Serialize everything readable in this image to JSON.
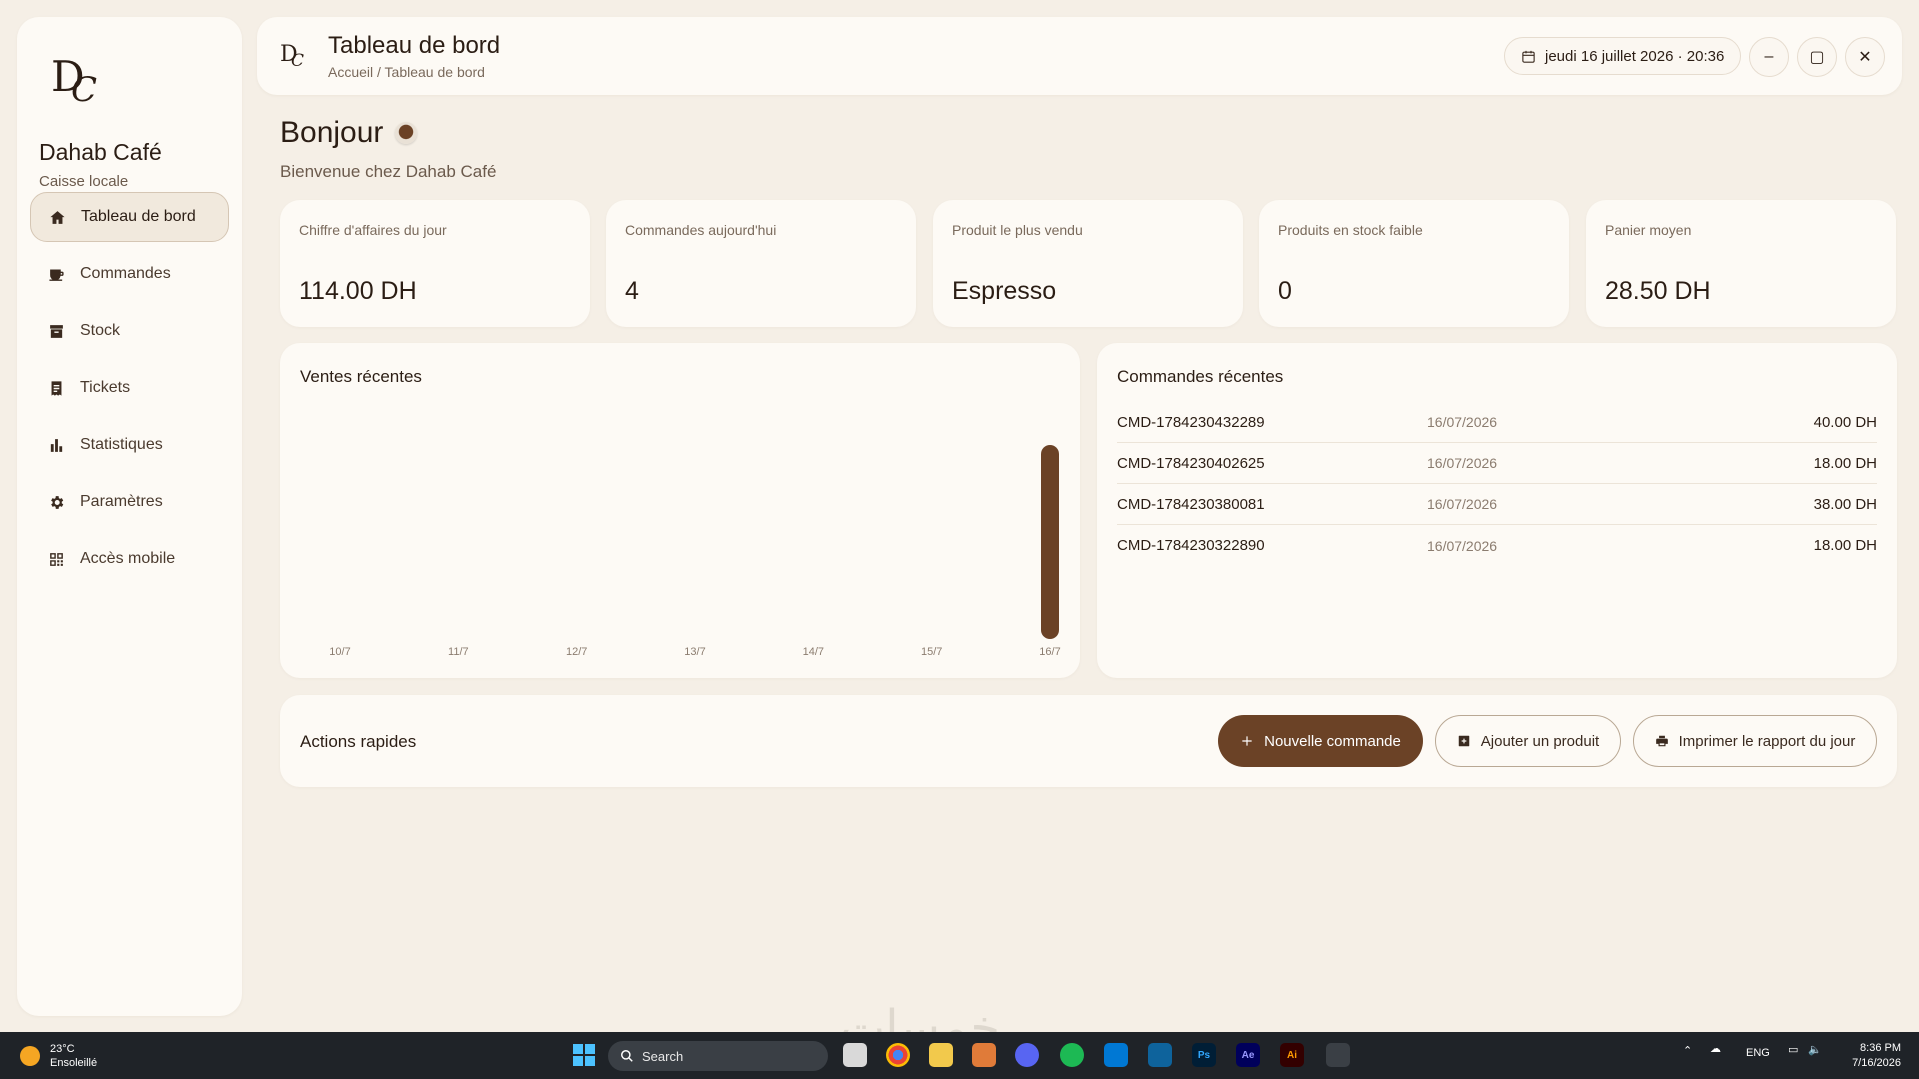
{
  "sidebar": {
    "brand_name": "Dahab Café",
    "brand_sub": "Caisse locale",
    "items": [
      {
        "label": "Tableau de bord",
        "icon": "home-icon"
      },
      {
        "label": "Commandes",
        "icon": "coffee-cup-icon"
      },
      {
        "label": "Stock",
        "icon": "archive-box-icon"
      },
      {
        "label": "Tickets",
        "icon": "receipt-icon"
      },
      {
        "label": "Statistiques",
        "icon": "bar-chart-icon"
      },
      {
        "label": "Paramètres",
        "icon": "gear-icon"
      },
      {
        "label": "Accès mobile",
        "icon": "qr-code-icon"
      }
    ]
  },
  "header": {
    "title": "Tableau de bord",
    "breadcrumb": "Accueil / Tableau de bord",
    "datetime": "jeudi 16 juillet 2026 · 20:36",
    "minimize": "–",
    "maximize": "▢",
    "close": "✕"
  },
  "greeting": {
    "title": "Bonjour",
    "subtitle": "Bienvenue chez Dahab Café"
  },
  "stats": [
    {
      "label": "Chiffre d'affaires du jour",
      "value": "114.00 DH"
    },
    {
      "label": "Commandes aujourd'hui",
      "value": "4"
    },
    {
      "label": "Produit le plus vendu",
      "value": "Espresso"
    },
    {
      "label": "Produits en stock faible",
      "value": "0"
    },
    {
      "label": "Panier moyen",
      "value": "28.50 DH"
    }
  ],
  "sales_panel": {
    "title": "Ventes récentes"
  },
  "chart_data": {
    "type": "bar",
    "categories": [
      "10/7",
      "11/7",
      "12/7",
      "13/7",
      "14/7",
      "15/7",
      "16/7"
    ],
    "values": [
      0,
      0,
      0,
      0,
      0,
      0,
      114
    ],
    "bar_color": "#6b4226",
    "grid": false
  },
  "orders_panel": {
    "title": "Commandes récentes",
    "rows": [
      {
        "id": "CMD-1784230432289",
        "date": "16/07/2026",
        "amount": "40.00 DH"
      },
      {
        "id": "CMD-1784230402625",
        "date": "16/07/2026",
        "amount": "18.00 DH"
      },
      {
        "id": "CMD-1784230380081",
        "date": "16/07/2026",
        "amount": "38.00 DH"
      },
      {
        "id": "CMD-1784230322890",
        "date": "16/07/2026",
        "amount": "18.00 DH"
      }
    ]
  },
  "quick_actions": {
    "title": "Actions rapides",
    "new_order": "Nouvelle commande",
    "add_product": "Ajouter un produit",
    "print_report": "Imprimer le rapport du jour"
  },
  "taskbar": {
    "temperature": "23°C",
    "weather": "Ensoleillé",
    "search_placeholder": "Search",
    "lang": "ENG",
    "time": "8:36 PM",
    "date": "7/16/2026"
  },
  "colors": {
    "accent": "#6b4226",
    "background": "#f5efe6",
    "card": "#fdfaf5"
  }
}
